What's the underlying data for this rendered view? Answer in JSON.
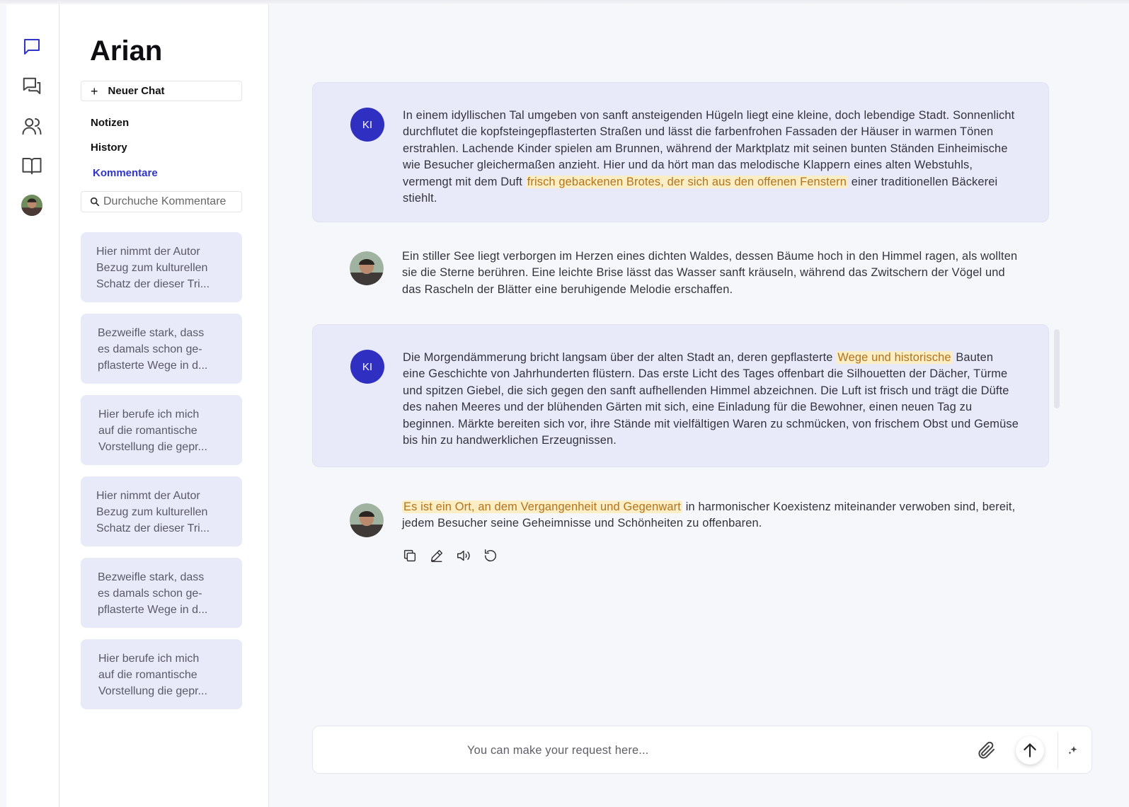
{
  "app": {
    "title": "Arian"
  },
  "rail": {
    "items": [
      {
        "icon": "chat-bubble-icon",
        "active": true
      },
      {
        "icon": "conversations-icon",
        "active": false
      },
      {
        "icon": "users-icon",
        "active": false
      },
      {
        "icon": "book-icon",
        "active": false
      },
      {
        "icon": "user-avatar",
        "active": false
      }
    ]
  },
  "sidebar": {
    "new_chat_icon": "+",
    "new_chat_label": "Neuer Chat",
    "nav": [
      {
        "label": "Notizen",
        "active": false
      },
      {
        "label": "History",
        "active": false
      },
      {
        "label": "Kommentare",
        "active": true
      }
    ],
    "search_placeholder": "Durchuche Kommentare",
    "comments": [
      {
        "lines": [
          "Hier nimmt der Autor",
          "Bezug zum kulturellen",
          "Schatz der dieser Tri..."
        ]
      },
      {
        "lines": [
          "Bezweifle stark, dass",
          "es damals schon ge-",
          "pflasterte Wege in d..."
        ]
      },
      {
        "lines": [
          "Hier berufe ich mich",
          "auf die romantische",
          "Vorstellung die gepr..."
        ]
      },
      {
        "lines": [
          "Hier nimmt der Autor",
          "Bezug zum kulturellen",
          "Schatz der dieser Tri..."
        ]
      },
      {
        "lines": [
          "Bezweifle stark, dass",
          "es damals schon ge-",
          "pflasterte Wege in d..."
        ]
      },
      {
        "lines": [
          "Hier berufe ich mich",
          "auf die romantische",
          "Vorstellung die gepr..."
        ]
      }
    ]
  },
  "messages": [
    {
      "role": "ai",
      "avatar_label": "KI",
      "pre": "In einem idyllischen Tal umgeben von sanft ansteigenden Hügeln liegt eine kleine, doch lebendige Stadt. Sonnenlicht durchflutet die kopfsteingepflasterten Straßen und lässt die farbenfrohen Fassaden der Häuser in warmen Tönen erstrahlen. Lachende Kinder spielen am Brunnen, während der Marktplatz mit seinen bunten Ständen Einheimische wie Besucher gleichermaßen anzieht. Hier und da hört man das melodische Klappern eines alten Webstuhls, vermengt mit dem Duft ",
      "highlight": "frisch gebackenen Brotes, der sich aus den offenen Fenstern",
      "post": " einer traditionellen Bäckerei stiehlt."
    },
    {
      "role": "user",
      "pre": "Ein stiller See liegt verborgen im Herzen eines dichten Waldes, dessen Bäume hoch in den Himmel ragen, als wollten sie die Sterne berühren. Eine leichte Brise lässt das Wasser sanft kräuseln, während das Zwitschern der Vögel und das Rascheln der Blätter eine beruhigende Melodie erschaffen.",
      "highlight": "",
      "post": ""
    },
    {
      "role": "ai",
      "avatar_label": "KI",
      "pre": "Die Morgendämmerung bricht langsam über der alten Stadt an, deren gepflasterte ",
      "highlight": "Wege und historische",
      "post": " Bauten eine Geschichte von Jahrhunderten flüstern. Das erste Licht des Tages offenbart die Silhouetten der Dächer, Türme und spitzen Giebel, die sich gegen den sanft aufhellenden Himmel abzeichnen. Die Luft ist frisch und trägt die Düfte des nahen Meeres und der blühenden Gärten mit sich, eine Einladung für die Bewohner, einen neuen Tag zu beginnen. Märkte bereiten sich vor, ihre Stände mit vielfältigen Waren zu schmücken, von frischem Obst und Gemüse bis hin zu handwerklichen Erzeugnissen."
    },
    {
      "role": "user",
      "pre": "",
      "highlight": "Es ist ein Ort, an dem Vergangenheit und Gegenwart",
      "post": " in harmonischer Koexistenz miteinander verwoben sind, bereit, jedem Besucher seine Geheimnisse und Schönheiten zu offenbaren."
    }
  ],
  "message_actions": [
    "copy-icon",
    "edit-icon",
    "speaker-icon",
    "regenerate-icon"
  ],
  "composer": {
    "placeholder": "You can make your request here...",
    "icons": [
      "paperclip-icon",
      "send-arrow-icon",
      "sparkle-icon"
    ]
  },
  "colors": {
    "accent": "#2f35c9",
    "ai_bubble": "#e8eafa",
    "highlight_bg": "#fbeec4",
    "highlight_text": "#b2731f"
  }
}
